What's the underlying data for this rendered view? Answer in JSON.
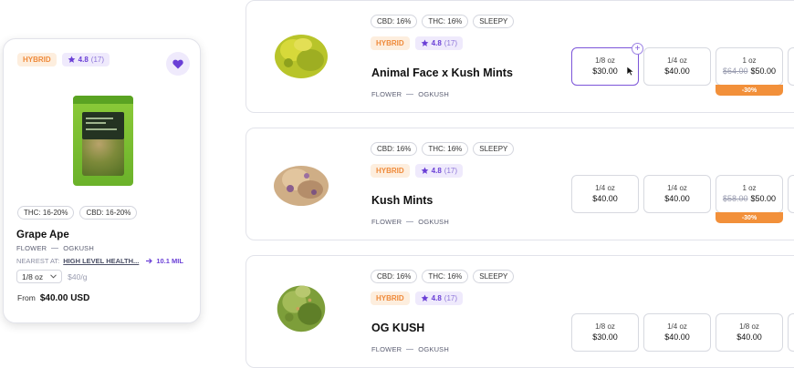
{
  "detail": {
    "strain": "HYBRID",
    "rating": "4.8",
    "rating_count": "(17)",
    "thc": "THC: 16-20%",
    "cbd": "CBD: 16-20%",
    "name": "Grape Ape",
    "category": "FLOWER",
    "brand": "OGKUSH",
    "nearest_label": "NEAREST AT:",
    "nearest_store": "HIGH LEVEL HEALTH...",
    "distance": "10.1 MIL",
    "size": "1/8 oz",
    "per_gram": "$40/g",
    "from_label": "From",
    "from_price": "$40.00 USD"
  },
  "products": [
    {
      "cbd": "CBD: 16%",
      "thc": "THC: 16%",
      "effect": "SLEEPY",
      "strain": "HYBRID",
      "rating": "4.8",
      "rating_count": "(17)",
      "name": "Animal Face x Kush Mints",
      "category": "FLOWER",
      "brand": "OGKUSH",
      "options": [
        {
          "size": "1/8 oz",
          "price": "$30.00",
          "selected": true
        },
        {
          "size": "1/4 oz",
          "price": "$40.00"
        },
        {
          "size": "1 oz",
          "old_price": "$64.00",
          "price": "$50.00",
          "discount": "-30%"
        }
      ]
    },
    {
      "cbd": "CBD: 16%",
      "thc": "THC: 16%",
      "effect": "SLEEPY",
      "strain": "HYBRID",
      "rating": "4.8",
      "rating_count": "(17)",
      "name": "Kush Mints",
      "category": "FLOWER",
      "brand": "OGKUSH",
      "options": [
        {
          "size": "1/4 oz",
          "price": "$40.00"
        },
        {
          "size": "1/4 oz",
          "price": "$40.00"
        },
        {
          "size": "1 oz",
          "old_price": "$58.00",
          "price": "$50.00",
          "discount": "-30%"
        }
      ]
    },
    {
      "cbd": "CBD: 16%",
      "thc": "THC: 16%",
      "effect": "SLEEPY",
      "strain": "HYBRID",
      "rating": "4.8",
      "rating_count": "(17)",
      "name": "OG KUSH",
      "category": "FLOWER",
      "brand": "OGKUSH",
      "options": [
        {
          "size": "1/8 oz",
          "price": "$30.00"
        },
        {
          "size": "1/4 oz",
          "price": "$40.00"
        },
        {
          "size": "1/8 oz",
          "price": "$40.00"
        }
      ]
    }
  ],
  "colors": {
    "accent": "#6a3fd6",
    "strain": "#ef8a3a",
    "discount": "#f2903a"
  }
}
